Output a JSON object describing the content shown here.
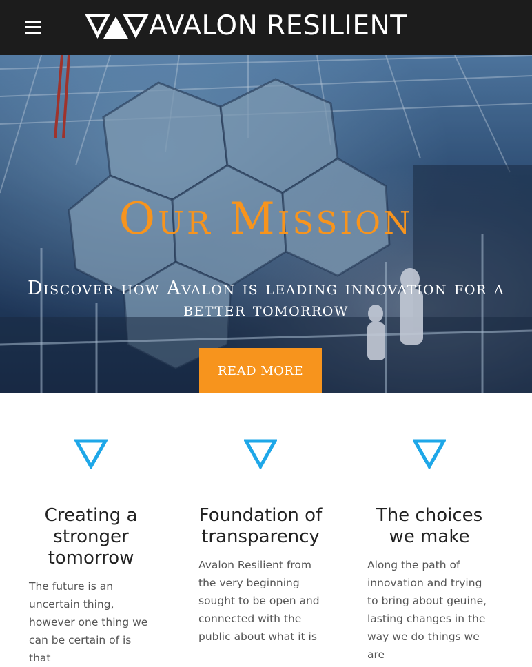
{
  "header": {
    "brand": "AVALON RESILIENT",
    "menu_icon": "hamburger-menu-icon"
  },
  "hero": {
    "title": "Our Mission",
    "subtitle": "Discover how Avalon is leading innovation for a better tomorrow",
    "button_label": "READ MORE",
    "accent_color": "#f7941d"
  },
  "features": [
    {
      "icon": "triangle-down-icon",
      "title": "Creating a stronger tomorrow",
      "text": "The future is an uncertain thing, however one thing we can be certain of is that"
    },
    {
      "icon": "triangle-down-icon",
      "title": "Foundation of transparency",
      "text": "Avalon Resilient from the very beginning sought to be open and connected with the public about what it is"
    },
    {
      "icon": "triangle-down-icon",
      "title": "The choices we make",
      "text": "Along the path of innovation and trying to bring about geuine, lasting changes in the way we do things we are"
    }
  ],
  "colors": {
    "header_bg": "#1c1c1c",
    "icon_blue": "#1ea7e8",
    "heading": "#222222",
    "body_text": "#555555"
  }
}
